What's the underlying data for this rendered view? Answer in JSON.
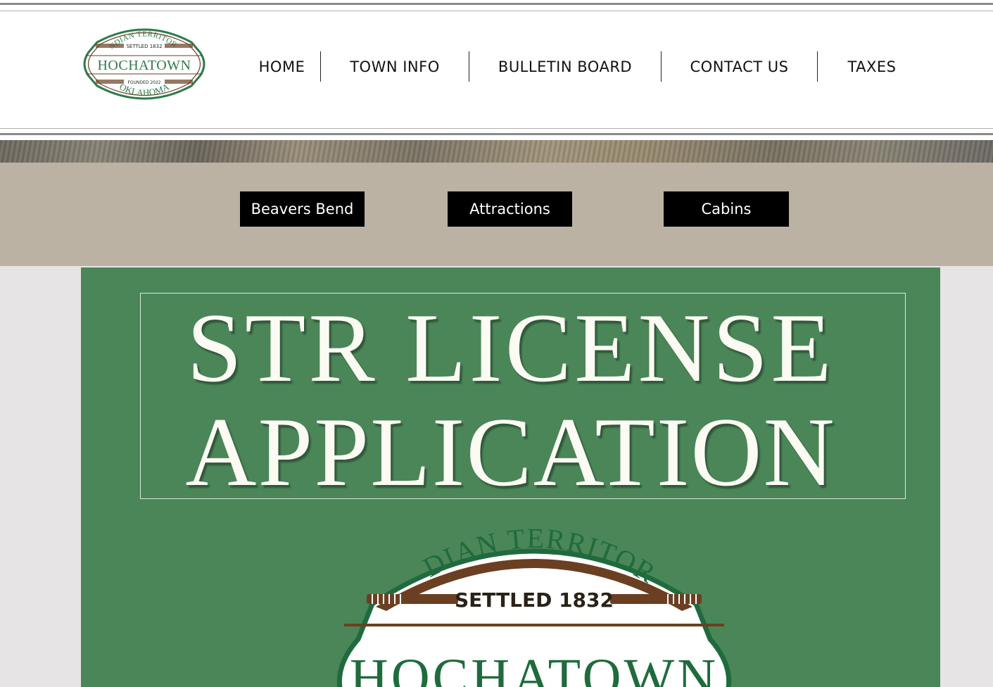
{
  "header": {
    "logo": {
      "arc_top": "INDIAN TERRITORY",
      "settled": "SETTLED 1832",
      "town": "HOCHATOWN",
      "founded": "FOUNDED 2022",
      "state": "OKLAHOMA",
      "icon": "town-seal-logo"
    },
    "nav": [
      {
        "label": "HOME"
      },
      {
        "label": "TOWN INFO"
      },
      {
        "label": "BULLETIN BOARD"
      },
      {
        "label": "CONTACT US"
      },
      {
        "label": "TAXES"
      }
    ]
  },
  "quick_links": [
    {
      "label": "Beavers Bend"
    },
    {
      "label": "Attractions"
    },
    {
      "label": "Cabins"
    }
  ],
  "poster": {
    "line1": "STR LICENSE",
    "line2": "APPLICATION",
    "seal": {
      "arc_top": "INDIAN TERRITORY",
      "settled": "SETTLED 1832",
      "town": "HOCHATOWN"
    }
  },
  "colors": {
    "tan_band": "#bcb2a3",
    "poster_green": "#4a8658",
    "seal_green": "#2e7a4b",
    "seal_brown": "#6b3f22"
  }
}
